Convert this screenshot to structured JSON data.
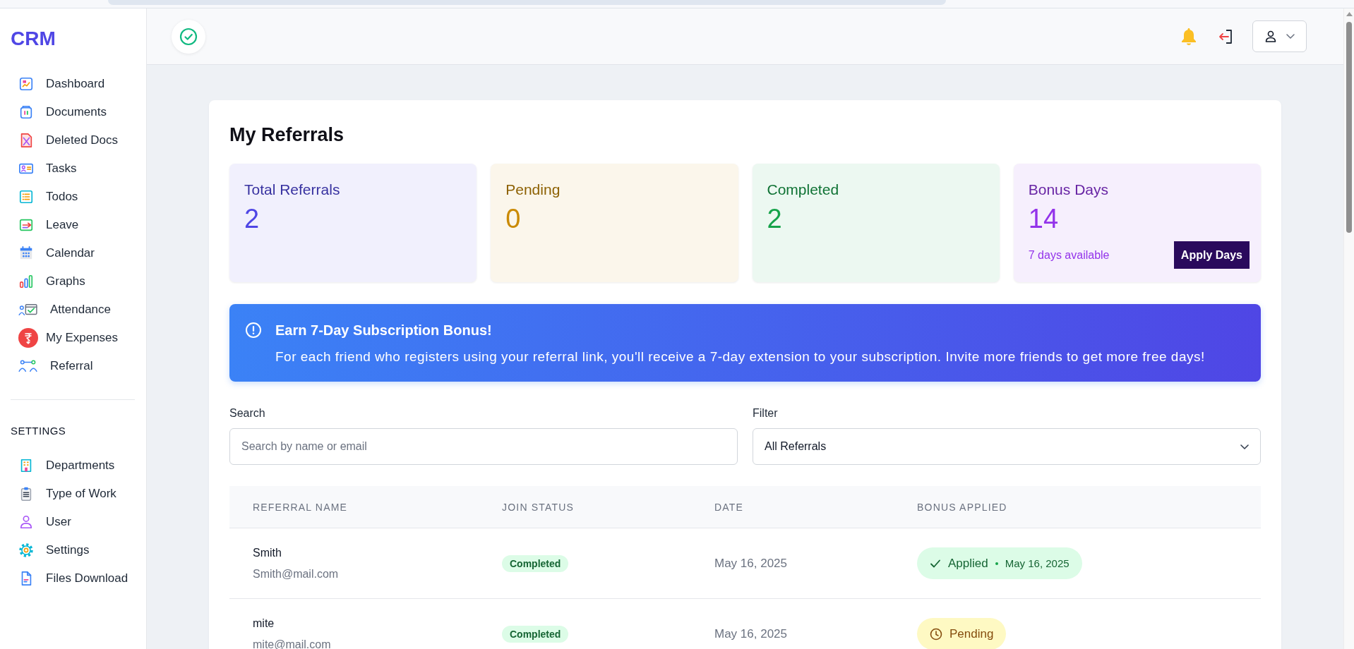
{
  "sidebar": {
    "logo": "CRM",
    "items": [
      "Dashboard",
      "Documents",
      "Deleted Docs",
      "Tasks",
      "Todos",
      "Leave",
      "Calendar",
      "Graphs",
      "Attendance",
      "My Expenses",
      "Referral"
    ],
    "settings_title": "SETTINGS",
    "settings_items": [
      "Departments",
      "Type of Work",
      "User",
      "Settings",
      "Files Download"
    ]
  },
  "page_title": "My Referrals",
  "stats": [
    {
      "label": "Total Referrals",
      "value": "2",
      "color": "#4f46e5"
    },
    {
      "label": "Pending",
      "value": "0",
      "color": "#ca8a04"
    },
    {
      "label": "Completed",
      "value": "2",
      "color": "#16a34a"
    },
    {
      "label": "Bonus Days",
      "value": "14",
      "color": "#9333ea",
      "note": "7 days available",
      "button": "Apply Days"
    }
  ],
  "banner": {
    "title": "Earn 7-Day Subscription Bonus!",
    "text": "For each friend who registers using your referral link, you'll receive a 7-day extension to your subscription. Invite more friends to get more free days!"
  },
  "search": {
    "label": "Search",
    "placeholder": "Search by name or email"
  },
  "filter": {
    "label": "Filter",
    "value": "All Referrals"
  },
  "table": {
    "columns": [
      "REFERRAL NAME",
      "JOIN STATUS",
      "DATE",
      "BONUS APPLIED"
    ],
    "rows": [
      {
        "name": "Smith",
        "email": "Smith@mail.com",
        "join_status": "Completed",
        "date": "May 16, 2025",
        "bonus": {
          "kind": "applied",
          "label": "Applied",
          "date": "May 16, 2025"
        }
      },
      {
        "name": "mite",
        "email": "mite@mail.com",
        "join_status": "Completed",
        "date": "May 16, 2025",
        "bonus": {
          "kind": "pending",
          "label": "Pending"
        }
      }
    ]
  }
}
